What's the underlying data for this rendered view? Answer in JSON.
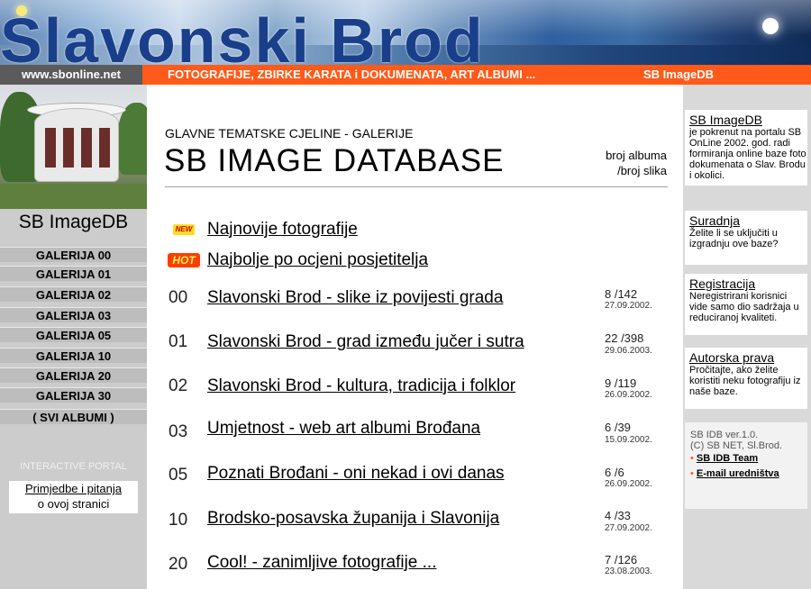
{
  "banner": {
    "title": "Slavonski Brod"
  },
  "navbar": {
    "site_url": "www.sbonline.net",
    "links_text": "FOTOGRAFIJE,  ZBIRKE KARATA i DOKUMENATA,   ART ALBUMI   ...",
    "imagedb_link": "SB ImageDB"
  },
  "left": {
    "title": "SB ImageDB",
    "galleries": [
      "GALERIJA  00",
      "GALERIJA  01",
      "GALERIJA  02",
      "GALERIJA  03",
      "GALERIJA  05",
      "GALERIJA  10",
      "GALERIJA  20",
      "GALERIJA  30",
      "( SVI ALBUMI )"
    ],
    "portal_label": "INTERACTIVE PORTAL",
    "feedback_link": "Primjedbe i pitanja",
    "feedback_sub": "o ovoj stranici"
  },
  "main": {
    "eyebrow": "GLAVNE TEMATSKE CJELINE - GALERIJE",
    "title": "SB  IMAGE  DATABASE",
    "count_header_1": "broj albuma",
    "count_header_2": "/broj slika",
    "new_badge": "NEW",
    "hot_badge": "HOT",
    "newest": "Najnovije fotografije",
    "best": "Najbolje po ocjeni posjetitelja",
    "rows": [
      {
        "num": "00",
        "title": "Slavonski Brod - slike iz povijesti grada",
        "count": "8 /142",
        "date": "27.09.2002."
      },
      {
        "num": "01",
        "title": "Slavonski Brod - grad između jučer i sutra",
        "count": "22 /398",
        "date": "29.06.2003."
      },
      {
        "num": "02",
        "title": "Slavonski Brod - kultura, tradicija i folklor",
        "count": "9 /119",
        "date": "26.09.2002."
      },
      {
        "num": "03",
        "title": "Umjetnost - web art albumi Brođana",
        "count": "6 /39",
        "date": "15.09.2002."
      },
      {
        "num": "05",
        "title": "Poznati Brođani - oni nekad i ovi danas",
        "count": "6 /6",
        "date": "26.09.2002."
      },
      {
        "num": "10",
        "title": "Brodsko-posavska županija i Slavonija",
        "count": "4 /33",
        "date": "27.09.2002."
      },
      {
        "num": "20",
        "title": "Cool! - zanimljive fotografije ...",
        "count": "7 /126",
        "date": "23.08.2003."
      }
    ]
  },
  "right": {
    "boxes": [
      {
        "title": "SB ImageDB",
        "text": "je pokrenut na portalu SB OnLine 2002. god. radi formiranja online baze foto dokumenata o Slav. Brodu i okolici."
      },
      {
        "title": "Suradnja",
        "text": "Želite li se uključiti u izgradnju ove baze?"
      },
      {
        "title": "Registracija",
        "text": "Neregistrirani korisnici vide samo dio sadržaja u reduciranoj kvaliteti."
      },
      {
        "title": "Autorska prava",
        "text": "Pročitajte, ako želite koristiti neku fotografiju iz naše baze."
      }
    ],
    "version": "SB IDB ver.1.0.",
    "copyright": "(C) SB NET, Sl.Brod.",
    "team_link": "SB IDB Team",
    "email_link": "E-mail uredništva"
  }
}
